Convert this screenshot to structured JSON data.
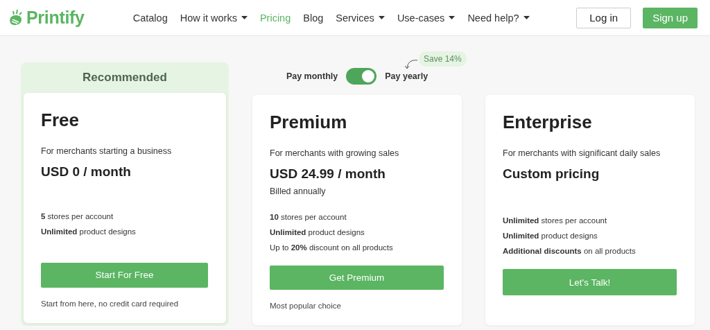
{
  "header": {
    "logo": "Printify",
    "nav": [
      {
        "label": "Catalog",
        "dropdown": false,
        "selected": false
      },
      {
        "label": "How it works",
        "dropdown": true,
        "selected": false
      },
      {
        "label": "Pricing",
        "dropdown": false,
        "selected": true
      },
      {
        "label": "Blog",
        "dropdown": false,
        "selected": false
      },
      {
        "label": "Services",
        "dropdown": true,
        "selected": false
      },
      {
        "label": "Use-cases",
        "dropdown": true,
        "selected": false
      },
      {
        "label": "Need help?",
        "dropdown": true,
        "selected": false
      }
    ],
    "login": "Log in",
    "signup": "Sign up"
  },
  "billing": {
    "left_label": "Pay monthly",
    "right_label": "Pay yearly",
    "on": true,
    "badge": "Save 14%"
  },
  "plans": [
    {
      "recommended": "Recommended",
      "name": "Free",
      "description": "For merchants starting a business",
      "price": "USD 0 / month",
      "features": [
        "**5** stores per account",
        "**Unlimited** product designs"
      ],
      "button": "Start For Free",
      "note": "Start from here, no credit card required"
    },
    {
      "name": "Premium",
      "description": "For merchants with growing sales",
      "price": "USD 24.99 / month",
      "billing_note": "Billed annually",
      "features": [
        "**10** stores per account",
        "**Unlimited** product designs",
        "Up to **20%** discount on all products"
      ],
      "button": "Get Premium",
      "note": "Most popular choice"
    },
    {
      "name": "Enterprise",
      "description": "For merchants with significant daily sales",
      "price": "Custom pricing",
      "features": [
        "**Unlimited** stores per account",
        "**Unlimited** product designs",
        "**Additional discounts** on all products"
      ],
      "button": "Let's Talk!"
    }
  ]
}
